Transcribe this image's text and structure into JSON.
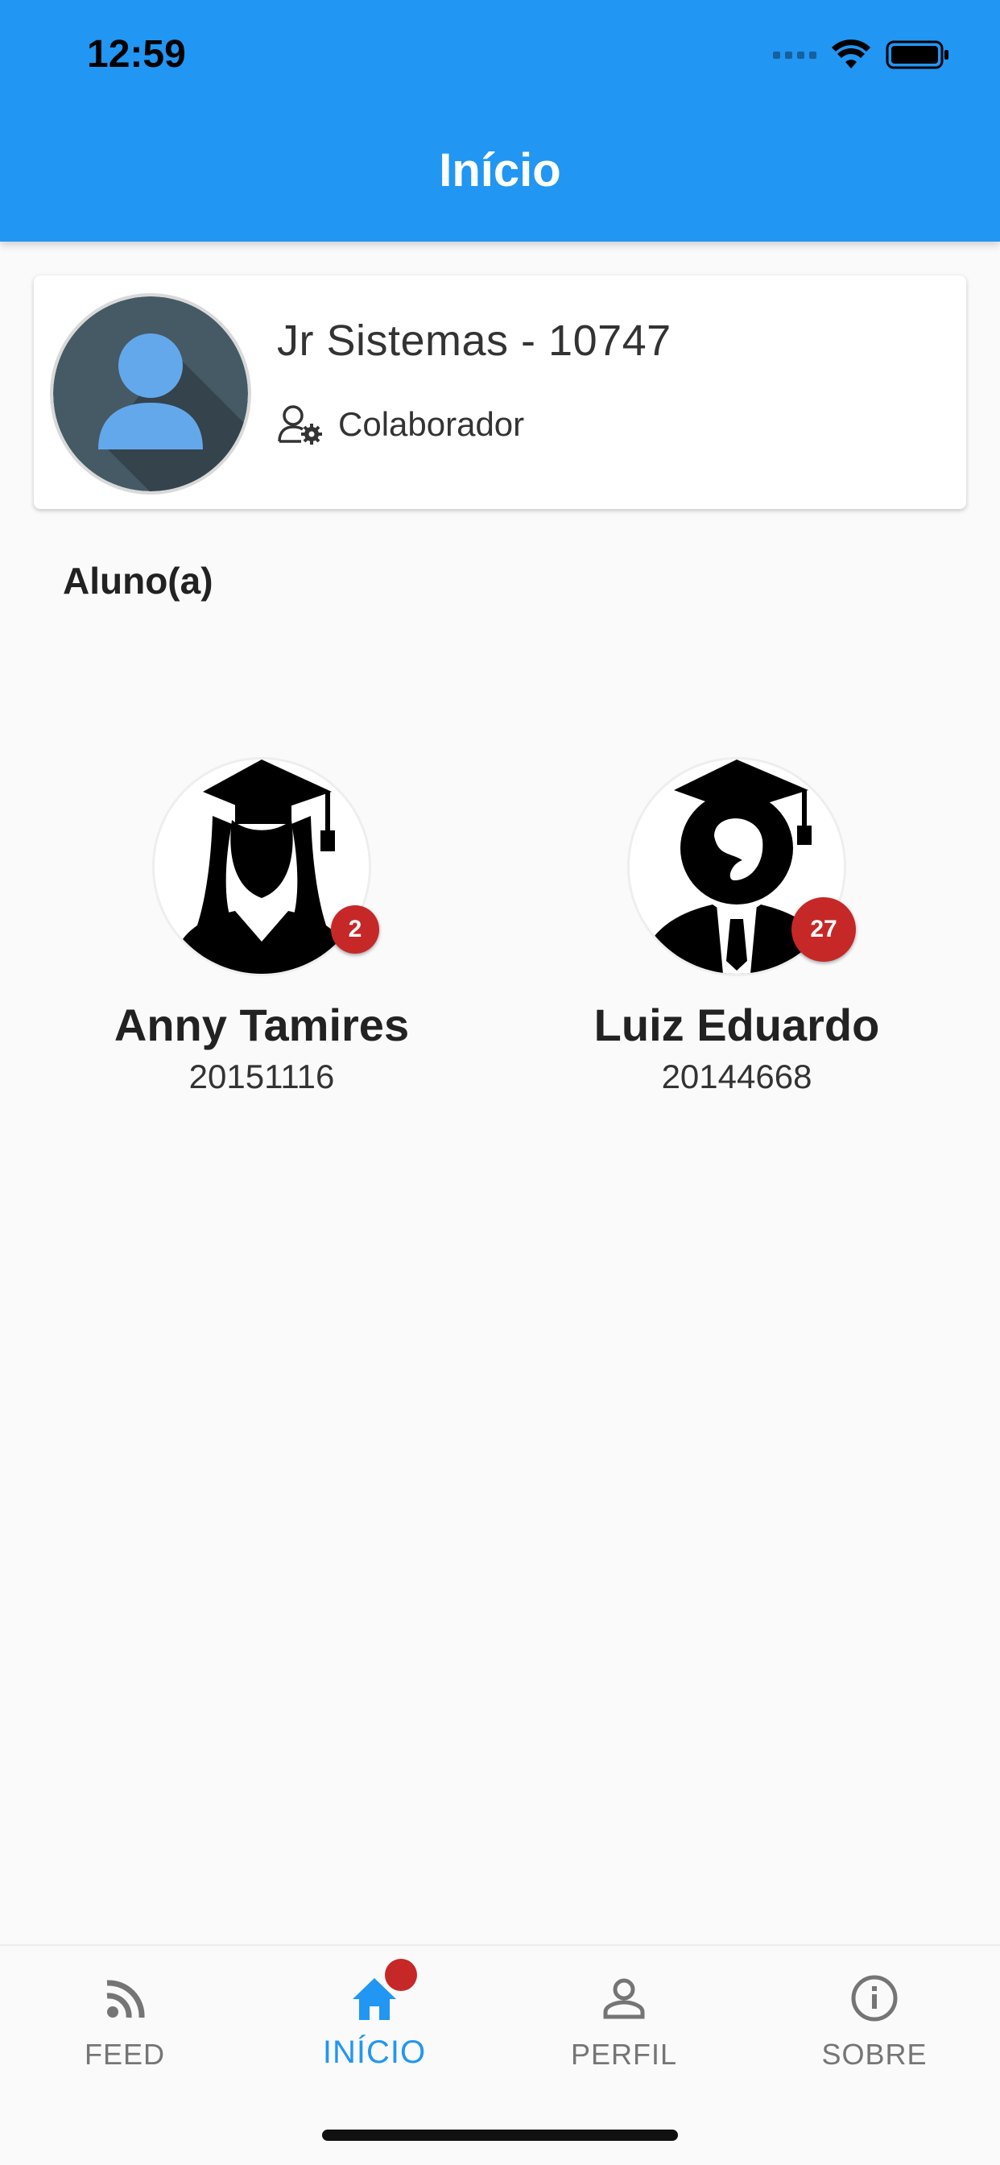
{
  "status_bar": {
    "time": "12:59"
  },
  "appbar": {
    "title": "Início"
  },
  "profile": {
    "name": "Jr Sistemas - 10747",
    "role": "Colaborador"
  },
  "section_title": "Aluno(a)",
  "students": [
    {
      "name": "Anny Tamires",
      "id": "20151116",
      "badge": "2"
    },
    {
      "name": "Luiz Eduardo",
      "id": "20144668",
      "badge": "27"
    }
  ],
  "nav": {
    "items": [
      {
        "label": "FEED",
        "icon": "rss-feed-icon"
      },
      {
        "label": "INÍCIO",
        "icon": "home-icon"
      },
      {
        "label": "PERFIL",
        "icon": "person-icon"
      },
      {
        "label": "SOBRE",
        "icon": "info-icon"
      }
    ]
  },
  "colors": {
    "primary": "#2196f3",
    "badge": "#c62828",
    "background": "#fafafa"
  }
}
